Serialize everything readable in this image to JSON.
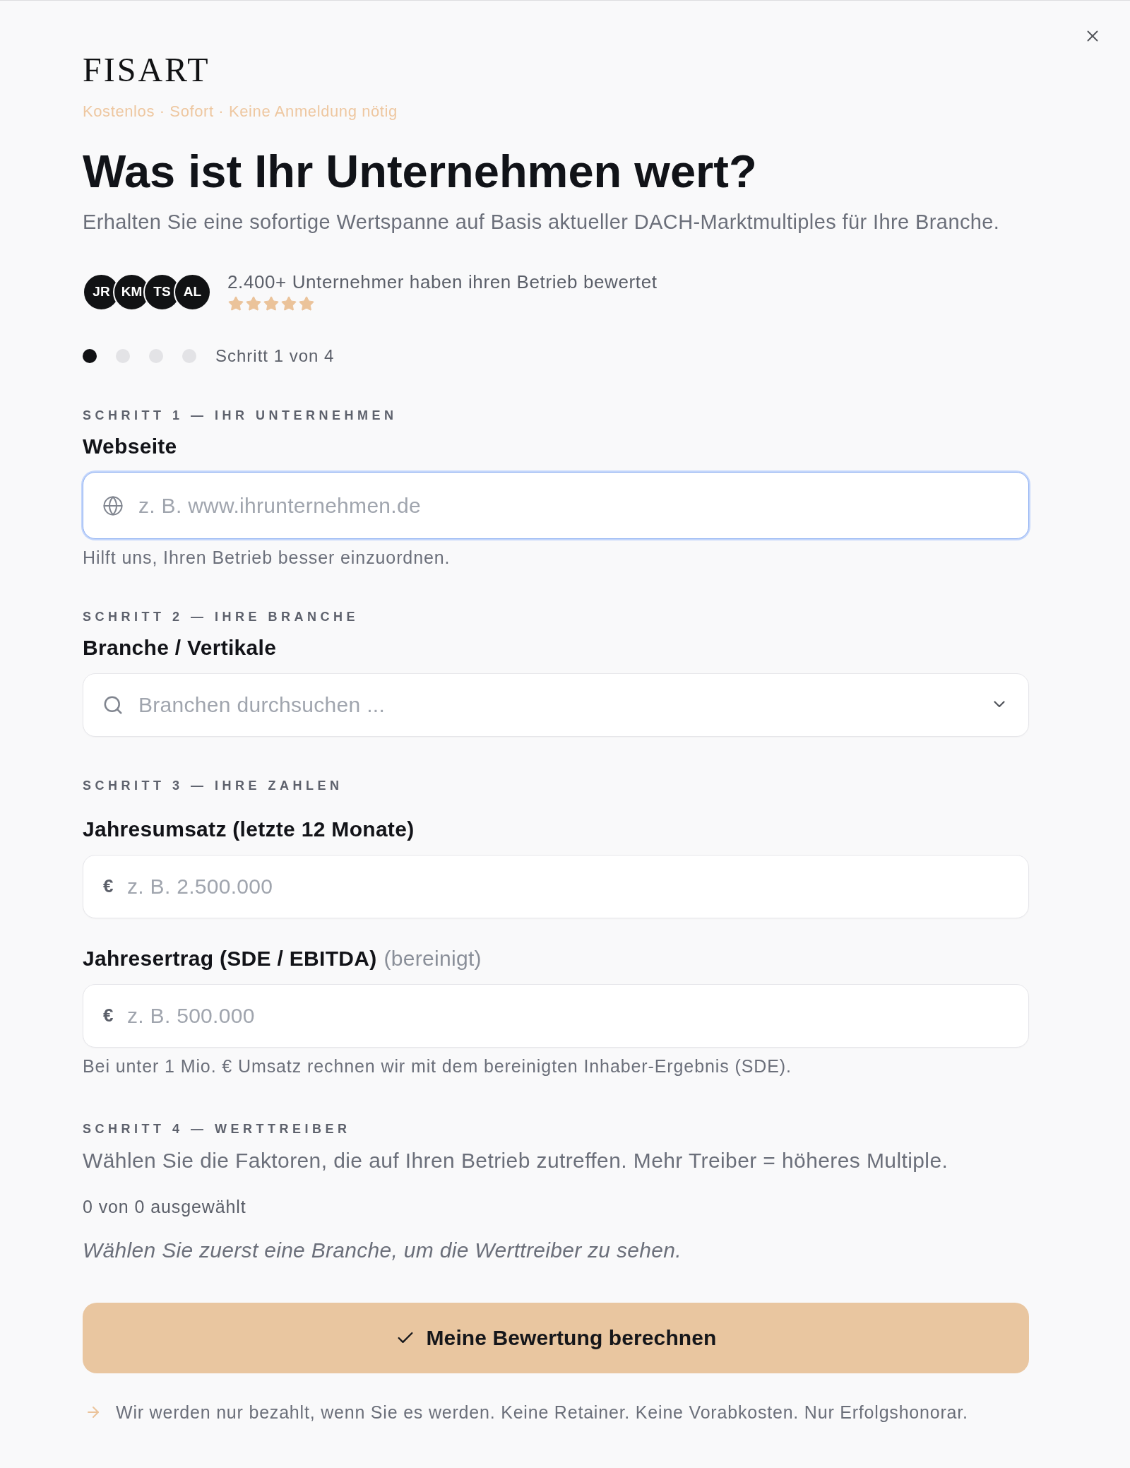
{
  "brand": {
    "logo": "FISART",
    "tagline": "Kostenlos · Sofort · Keine Anmeldung nötig"
  },
  "hero": {
    "title": "Was ist Ihr Unternehmen wert?",
    "subtitle": "Erhalten Sie eine sofortige Wertspanne auf Basis aktueller DACH-Marktmultiples für Ihre Branche."
  },
  "social_proof": {
    "avatars": [
      "JR",
      "KM",
      "TS",
      "AL"
    ],
    "text": "2.400+ Unternehmer haben ihren Betrieb bewertet",
    "stars": 5
  },
  "stepper": {
    "steps": [
      {
        "selected": true
      },
      {
        "selected": false
      },
      {
        "selected": false
      },
      {
        "selected": false
      }
    ],
    "label": "Schritt 1 von 4"
  },
  "sections": [
    {
      "heading": "SCHRITT 1 — IHR UNTERNEHMEN",
      "fields": [
        {
          "kind": "url",
          "label": "Webseite",
          "placeholder": "z. B. www.ihrunternehmen.de",
          "focused": true,
          "help": "Hilft uns, Ihren Betrieb besser einzuordnen."
        }
      ]
    },
    {
      "heading": "SCHRITT 2 — IHRE BRANCHE",
      "fields": [
        {
          "kind": "search_select",
          "label": "Branche / Vertikale",
          "placeholder": "Branchen durchsuchen ...",
          "focused": false
        }
      ]
    },
    {
      "heading": "SCHRITT 3 — IHRE ZAHLEN",
      "fields": [
        {
          "kind": "currency",
          "label": "Jahresumsatz (letzte 12 Monate)",
          "prefix": "€",
          "placeholder": "z. B. 2.500.000",
          "focused": false
        },
        {
          "kind": "currency",
          "label": "Jahresertrag (SDE / EBITDA)",
          "note": "(bereinigt)",
          "prefix": "€",
          "placeholder": "z. B. 500.000",
          "focused": false,
          "help": "Bei unter 1 Mio. € Umsatz rechnen wir mit dem bereinigten Inhaber-Ergebnis (SDE)."
        }
      ]
    },
    {
      "heading": "SCHRITT 4 — WERTTREIBER",
      "description": "Wählen Sie die Faktoren, die auf Ihren Betrieb zutreffen. Mehr Treiber = höheres Multiple.",
      "count": "0 von 0 ausgewählt",
      "empty_hint": "Wählen Sie zuerst eine Branche, um die Werttreiber zu sehen."
    }
  ],
  "submit": {
    "label": "Meine Bewertung berechnen"
  },
  "footer": {
    "text": "Wir werden nur bezahlt, wenn Sie es werden. Keine Retainer. Keine Vorabkosten. Nur Erfolgshonorar."
  }
}
